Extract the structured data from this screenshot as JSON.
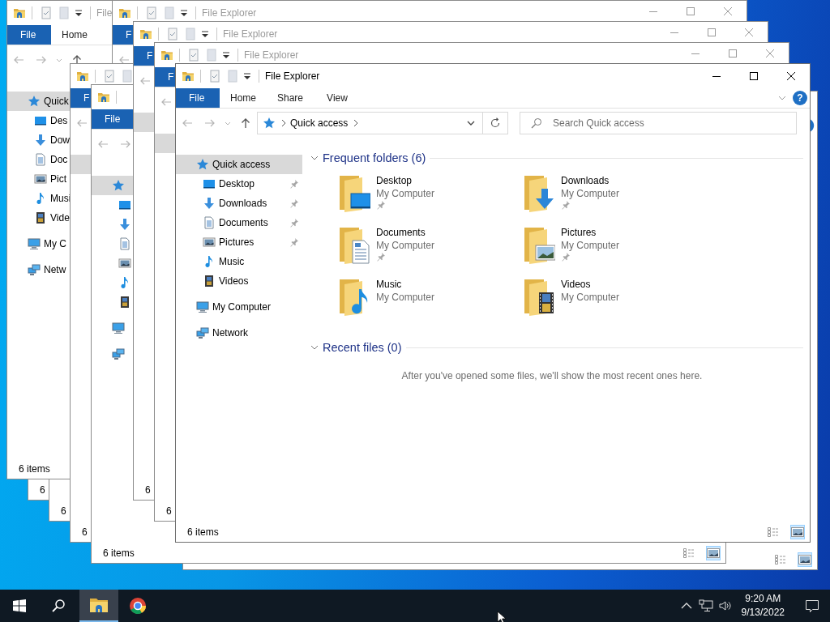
{
  "windows": [
    {
      "status": "6"
    },
    {
      "status": "6"
    },
    {
      "active": false,
      "title": "File",
      "tabs": [
        {
          "kind": "menu",
          "label": "File"
        },
        {
          "kind": "tab",
          "label": "Home"
        }
      ],
      "sidebar": [
        {
          "kind": "quick",
          "label": "Quick",
          "selected": true,
          "children": [
            {
              "kind": "desktop",
              "label": "Des",
              "selected": false
            },
            {
              "kind": "downloads",
              "label": "Dow",
              "selected": false
            },
            {
              "kind": "documents",
              "label": "Doc",
              "selected": false
            },
            {
              "kind": "pictures",
              "label": "Pict",
              "selected": false
            },
            {
              "kind": "music",
              "label": "Musi",
              "selected": false
            },
            {
              "kind": "videos",
              "label": "Vide",
              "selected": false
            }
          ]
        },
        {
          "kind": "computer",
          "label": "My C",
          "selected": false
        },
        {
          "kind": "network",
          "label": "Netw",
          "selected": false
        }
      ],
      "status": "6 items"
    },
    {
      "active": false,
      "title": "File Explorer",
      "tabs": [
        {
          "kind": "menu",
          "label": "F"
        }
      ]
    },
    {
      "tabs": [
        {
          "kind": "menu",
          "label": "F"
        }
      ],
      "sidebar": [
        {
          "selected": true
        }
      ],
      "status": "6"
    },
    {
      "views": [
        {
          "kind": "details",
          "selected": false
        },
        {
          "kind": "large-icons",
          "selected": true
        }
      ]
    },
    {
      "tabs": [
        {
          "kind": "menu",
          "label": "File"
        }
      ],
      "sidebar": [
        {
          "kind": "quick",
          "selected": true,
          "children": [
            {
              "kind": "desktop"
            },
            {
              "kind": "downloads"
            },
            {
              "kind": "documents"
            },
            {
              "kind": "pictures"
            },
            {
              "kind": "music"
            },
            {
              "kind": "videos"
            }
          ]
        },
        {
          "kind": "computer"
        },
        {
          "kind": "network"
        }
      ],
      "status": "6 items",
      "views": [
        {
          "kind": "details",
          "selected": false
        },
        {
          "kind": "large-icons",
          "selected": true
        }
      ]
    },
    {
      "active": false,
      "title": "File Explorer",
      "tabs": [
        {
          "kind": "menu",
          "label": "F"
        }
      ],
      "sidebar": [
        {
          "selected": true
        }
      ],
      "status": "6"
    },
    {
      "active": false,
      "title": "File Explorer",
      "tabs": [
        {
          "kind": "menu",
          "label": "F"
        }
      ],
      "sidebar": [
        {
          "selected": true
        }
      ],
      "status": "6"
    },
    {
      "active": true,
      "title": "File Explorer",
      "tabs": [
        {
          "kind": "menu",
          "label": "File"
        },
        {
          "kind": "tab",
          "label": "Home"
        },
        {
          "kind": "tab",
          "label": "Share"
        },
        {
          "kind": "tab",
          "label": "View"
        }
      ],
      "help": "?",
      "address": {
        "path": "Quick access"
      },
      "search": {
        "placeholder": "Search Quick access"
      },
      "sidebar": [
        {
          "kind": "quick",
          "label": "Quick access",
          "selected": true,
          "children": [
            {
              "kind": "desktop",
              "label": "Desktop",
              "selected": false,
              "pinned": true
            },
            {
              "kind": "downloads",
              "label": "Downloads",
              "selected": false,
              "pinned": true
            },
            {
              "kind": "documents",
              "label": "Documents",
              "selected": false,
              "pinned": true
            },
            {
              "kind": "pictures",
              "label": "Pictures",
              "selected": false,
              "pinned": true
            },
            {
              "kind": "music",
              "label": "Music",
              "selected": false,
              "pinned": false
            },
            {
              "kind": "videos",
              "label": "Videos",
              "selected": false,
              "pinned": false
            }
          ]
        },
        {
          "kind": "computer",
          "label": "My Computer",
          "selected": false
        },
        {
          "kind": "network",
          "label": "Network",
          "selected": false
        }
      ],
      "sections": [
        {
          "title": "Frequent folders (6)",
          "expanded": true,
          "folders": [
            {
              "kind": "desktop",
              "name": "Desktop",
              "location": "My Computer",
              "pinned": true
            },
            {
              "kind": "downloads",
              "name": "Downloads",
              "location": "My Computer",
              "pinned": true
            },
            {
              "kind": "documents",
              "name": "Documents",
              "location": "My Computer",
              "pinned": true
            },
            {
              "kind": "pictures",
              "name": "Pictures",
              "location": "My Computer",
              "pinned": true
            },
            {
              "kind": "music",
              "name": "Music",
              "location": "My Computer",
              "pinned": false
            },
            {
              "kind": "videos",
              "name": "Videos",
              "location": "My Computer",
              "pinned": false
            }
          ]
        },
        {
          "title": "Recent files (0)",
          "expanded": true,
          "message": "After you've opened some files, we'll show the most recent ones here."
        }
      ],
      "status": "6 items",
      "views": [
        {
          "kind": "details",
          "selected": false
        },
        {
          "kind": "large-icons",
          "selected": true
        }
      ]
    }
  ],
  "taskbar": {
    "apps": [
      {
        "kind": "explorer",
        "active": true
      },
      {
        "kind": "browser",
        "active": false
      }
    ],
    "time": "9:20 AM",
    "date": "9/13/2022"
  }
}
